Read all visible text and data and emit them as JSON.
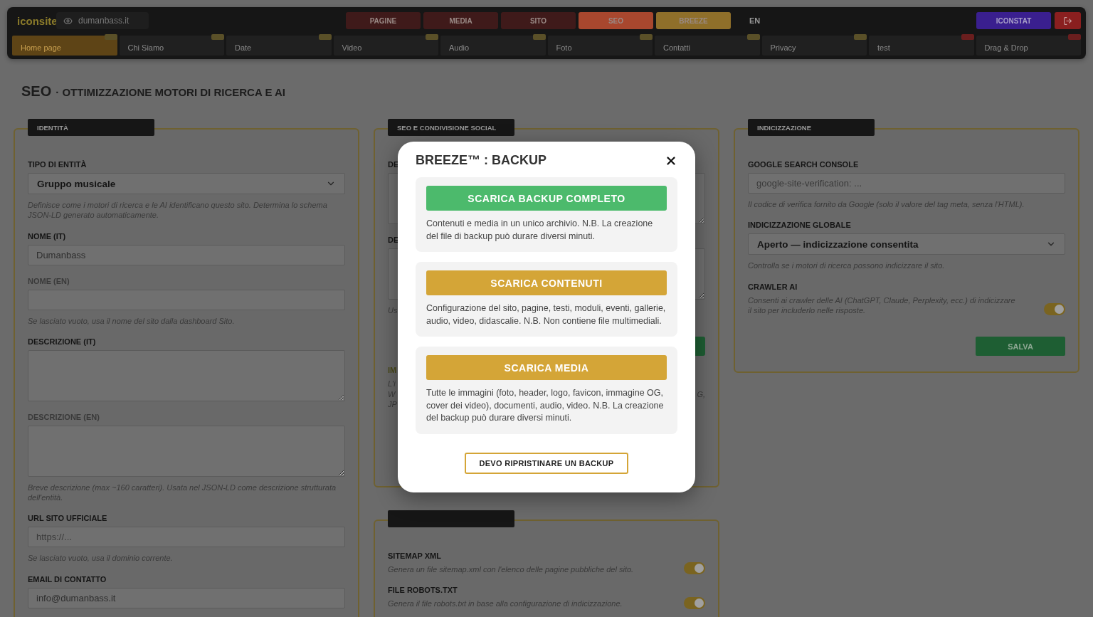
{
  "nav": {
    "logo": "iconsite",
    "site": "dumanbass.it",
    "menu": [
      {
        "label": "PAGINE",
        "color": "#3f1a1a"
      },
      {
        "label": "MEDIA",
        "color": "#3f1a1a"
      },
      {
        "label": "SITO",
        "color": "#3f1a1a"
      },
      {
        "label": "SEO",
        "color": "#a8472e"
      },
      {
        "label": "BREEZE",
        "color": "#8f6f2a"
      }
    ],
    "language": "EN",
    "stats_button": "ICONSTAT",
    "pages": [
      {
        "label": "Home page",
        "color": "#5a5028",
        "selected": true
      },
      {
        "label": "Chi Siamo",
        "color": "#5a5028",
        "selected": false
      },
      {
        "label": "Date",
        "color": "#5a5028",
        "selected": false
      },
      {
        "label": "Video",
        "color": "#5a5028",
        "selected": false
      },
      {
        "label": "Audio",
        "color": "#5a5028",
        "selected": false
      },
      {
        "label": "Foto",
        "color": "#5a5028",
        "selected": false
      },
      {
        "label": "Contatti",
        "color": "#5a5028",
        "selected": false
      },
      {
        "label": "Privacy",
        "color": "#5a5028",
        "selected": false
      },
      {
        "label": "test",
        "color": "#6a1e1e",
        "selected": false
      },
      {
        "label": "Drag & Drop",
        "color": "#6a1e1e",
        "selected": false
      }
    ]
  },
  "title": {
    "prefix": "SEO",
    "text": "· OTTIMIZZAZIONE MOTORI DI RICERCA E AI"
  },
  "identity": {
    "header": "IDENTITÀ",
    "fields": [
      {
        "kind": "select",
        "label": "TIPO DI ENTITÀ",
        "muted": false,
        "value": "Gruppo musicale",
        "hint": "Definisce come i motori di ricerca e le AI identificano questo sito. Determina lo schema JSON-LD generato automaticamente."
      },
      {
        "kind": "input",
        "label": "NOME (IT)",
        "muted": false,
        "value": "Dumanbass"
      },
      {
        "kind": "input",
        "label": "NOME (EN)",
        "muted": true,
        "hint": "Se lasciato vuoto, usa il nome del sito dalla dashboard Sito."
      },
      {
        "kind": "textarea",
        "label": "DESCRIZIONE (IT)",
        "muted": false
      },
      {
        "kind": "textarea",
        "label": "DESCRIZIONE (EN)",
        "muted": true,
        "hint": "Breve descrizione (max ~160 caratteri). Usata nel JSON-LD come descrizione strutturata dell'entità."
      },
      {
        "kind": "input",
        "label": "URL SITO UFFICIALE",
        "muted": false,
        "placeholder": "https://...",
        "hint": "Se lasciato vuoto, usa il dominio corrente."
      },
      {
        "kind": "input",
        "label": "EMAIL DI CONTATTO",
        "muted": false,
        "value": "info@dumanbass.it"
      }
    ]
  },
  "social": {
    "header": "SEO E CONDIVISIONE SOCIAL",
    "label_1": "DE",
    "label_2": "DE",
    "hint_1": "Us",
    "image_label": "IM",
    "image_hint_lines": [
      "L'i",
      "W",
      "JP"
    ],
    "image_hint_end": "G,"
  },
  "files": {
    "toggles": [
      {
        "label": "SITEMAP XML",
        "hint": "Genera un file sitemap.xml con l'elenco delle pagine pubbliche del sito.",
        "on": true
      },
      {
        "label": "FILE ROBOTS.TXT",
        "hint": "Genera il file robots.txt in base alla configurazione di indicizzazione.",
        "on": true
      }
    ]
  },
  "indexing": {
    "header": "INDICIZZAZIONE",
    "fields": [
      {
        "kind": "input",
        "label": "GOOGLE SEARCH CONSOLE",
        "muted": false,
        "placeholder": "google-site-verification: ...",
        "hint": "Il codice di verifica fornito da Google (solo il valore del tag meta, senza l'HTML)."
      },
      {
        "kind": "select",
        "label": "INDICIZZAZIONE GLOBALE",
        "muted": false,
        "value": "Aperto — indicizzazione consentita",
        "hint": "Controlla se i motori di ricerca possono indicizzare il sito."
      }
    ],
    "crawler": {
      "label": "CRAWLER AI",
      "hint": "Consenti ai crawler delle AI (ChatGPT, Claude, Perplexity, ecc.) di indicizzare il sito per includerlo nelle risposte.",
      "on": true
    },
    "save": "SALVA"
  },
  "modal": {
    "title": "BREEZE™ : BACKUP",
    "options": [
      {
        "kind": "primary",
        "button": "SCARICA BACKUP COMPLETO",
        "text": "Contenuti e media in un unico archivio. N.B. La creazione del file di backup può durare diversi minuti."
      },
      {
        "kind": "secondary",
        "button": "SCARICA CONTENUTI",
        "text": "Configurazione del sito, pagine, testi, moduli, eventi, gallerie, audio, video, didascalie. N.B. Non contiene file multimediali."
      },
      {
        "kind": "secondary",
        "button": "SCARICA MEDIA",
        "text": "Tutte le immagini (foto, header, logo, favicon, immagine OG, cover dei video), documenti, audio, video. N.B. La creazione del backup può durare diversi minuti."
      }
    ],
    "restore": "DEVO RIPRISTINARE UN BACKUP"
  }
}
